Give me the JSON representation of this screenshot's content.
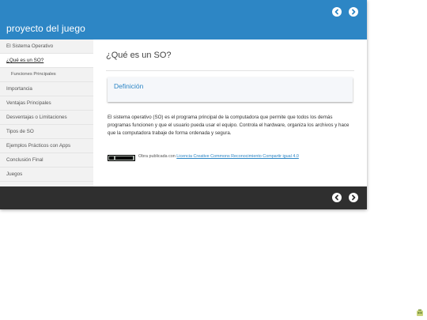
{
  "header": {
    "site_title": "proyecto del juego"
  },
  "sidebar": {
    "items": [
      {
        "label": "El Sistema Operativo"
      },
      {
        "label": "¿Qué es un SO?",
        "active": true
      },
      {
        "label": "Funciones Principales",
        "sub": true
      },
      {
        "label": "Importancia"
      },
      {
        "label": "Ventajas Principales"
      },
      {
        "label": "Desventajas o Limitaciones"
      },
      {
        "label": "Tipos de SO"
      },
      {
        "label": "Ejemplos Prácticos con Apps"
      },
      {
        "label": "Conclusión Final"
      },
      {
        "label": "Juegos"
      }
    ]
  },
  "main": {
    "title": "¿Qué es un SO?",
    "definition_title": "Definición",
    "body": "El sistema operativo (SO) es el programa principal de la computadora que permite que todos los demás programas funcionen y que el usuario pueda usar el equipo. Controla el hardware, organiza los archivos y hace que la computadora trabaje de forma ordenada y segura.",
    "license_prefix": "Obra publicada con ",
    "license_link": "Licencia Creative Commons Reconocimiento Compartir igual 4.0",
    "license_badge": "CC BY SA"
  },
  "icons": {
    "prev": "chevron-left-icon",
    "next": "chevron-right-icon"
  },
  "colors": {
    "header": "#2d86c5",
    "footer": "#2f2f2f",
    "sidebar": "#f2f2f2",
    "accent": "#2d86c5"
  }
}
